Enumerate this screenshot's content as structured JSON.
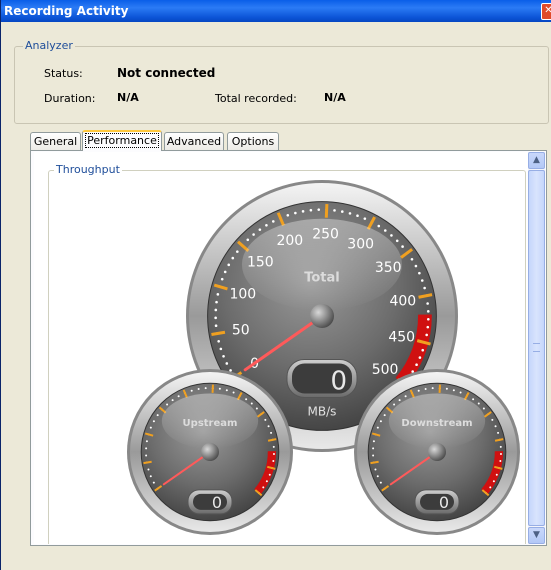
{
  "window": {
    "title": "Recording Activity",
    "close_icon": "close-icon"
  },
  "analyzer": {
    "group_title": "Analyzer",
    "status_label": "Status:",
    "status_value": "Not connected",
    "duration_label": "Duration:",
    "duration_value": "N/A",
    "total_recorded_label": "Total recorded:",
    "total_recorded_value": "N/A"
  },
  "tabs": [
    {
      "label": "General",
      "active": false
    },
    {
      "label": "Performance",
      "active": true
    },
    {
      "label": "Advanced",
      "active": false
    },
    {
      "label": "Options",
      "active": false
    }
  ],
  "performance": {
    "throughput_title": "Throughput",
    "total_gauge": {
      "label": "Total",
      "unit": "MB/s",
      "value": 0,
      "display": "0",
      "ticks": [
        "0",
        "50",
        "100",
        "150",
        "200",
        "250",
        "300",
        "350",
        "400",
        "450",
        "500"
      ],
      "max": 500
    },
    "upstream_gauge": {
      "label": "Upstream",
      "value": 0,
      "display": "0"
    },
    "downstream_gauge": {
      "label": "Downstream",
      "value": 0,
      "display": "0"
    }
  },
  "colors": {
    "accent_red": "#d01010",
    "tick_orange": "#f0a020",
    "title_bar": "#0a5ee8",
    "group_title": "#1f4e9a"
  },
  "scrollbar": {
    "up_icon": "scroll-up-icon",
    "down_icon": "scroll-down-icon"
  }
}
